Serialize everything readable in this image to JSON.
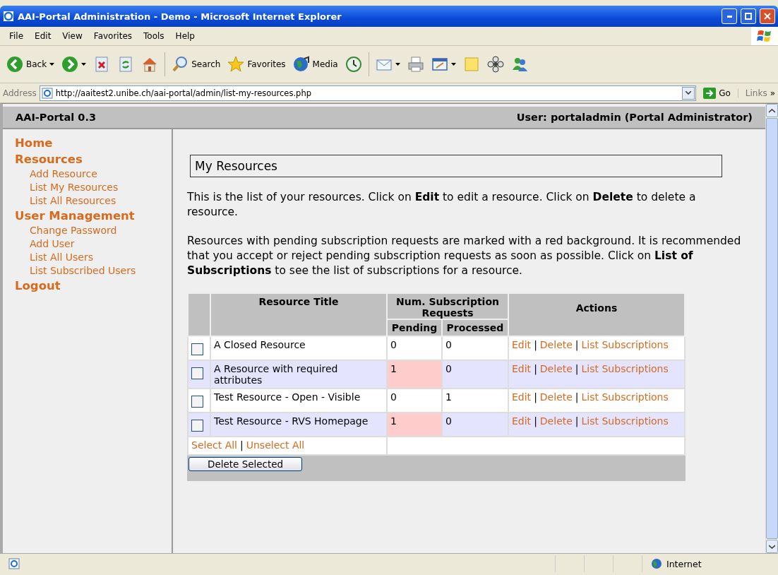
{
  "window": {
    "title": "AAI-Portal Administration - Demo - Microsoft Internet Explorer"
  },
  "menu": [
    "File",
    "Edit",
    "View",
    "Favorites",
    "Tools",
    "Help"
  ],
  "toolbar": [
    {
      "kind": "back",
      "label": "Back",
      "dropdown": true
    },
    {
      "kind": "forward",
      "dropdown": true
    },
    {
      "kind": "stop",
      "dropdown": false
    },
    {
      "kind": "refresh",
      "dropdown": false
    },
    {
      "kind": "home",
      "dropdown": false
    },
    {
      "kind": "search",
      "label": "Search",
      "dropdown": false
    },
    {
      "kind": "favorites",
      "label": "Favorites",
      "dropdown": false
    },
    {
      "kind": "media",
      "label": "Media",
      "dropdown": false
    },
    {
      "kind": "history",
      "dropdown": false
    },
    {
      "kind": "mail",
      "dropdown": true
    },
    {
      "kind": "print",
      "dropdown": false
    },
    {
      "kind": "edit",
      "dropdown": true
    },
    {
      "kind": "note",
      "dropdown": false
    },
    {
      "kind": "flower",
      "dropdown": false
    },
    {
      "kind": "messenger",
      "dropdown": false
    }
  ],
  "address": {
    "label": "Address",
    "value": "http://aaitest2.unibe.ch/aai-portal/admin/list-my-resources.php",
    "go": "Go",
    "links": "Links",
    "more": "»"
  },
  "portal": {
    "name": "AAI-Portal 0.3",
    "user": "User: portaladmin (Portal Administrator)"
  },
  "sidebar": [
    {
      "label": "Home"
    },
    {
      "label": "Resources",
      "children": [
        {
          "label": "Add Resource"
        },
        {
          "label": "List My Resources"
        },
        {
          "label": "List All Resources"
        }
      ]
    },
    {
      "label": "User Management",
      "children": [
        {
          "label": "Change Password"
        },
        {
          "label": "Add User"
        },
        {
          "label": "List All Users"
        },
        {
          "label": "List Subscribed Users"
        }
      ]
    },
    {
      "label": "Logout"
    }
  ],
  "heading": "My Resources",
  "paragraphs": [
    "This is the list of your resources. Click on **Edit** to edit a resource. Click on **Delete** to delete a resource.",
    "Resources with pending subscription requests are marked with a red background. It is recommended that you accept or reject pending subscription requests as soon as possible. Click on **List of Subscriptions** to see the list of subscriptions for a resource."
  ],
  "table": {
    "columns": {
      "title": "Resource Title",
      "requests": "Num. Subscription Requests",
      "pending": "Pending",
      "processed": "Processed",
      "actions": "Actions"
    },
    "rows": [
      {
        "title": "A Closed Resource",
        "pending": "0",
        "processed": "0",
        "checked": false,
        "highlighted": false,
        "actions": [
          "Edit",
          "Delete",
          "List Subscriptions"
        ]
      },
      {
        "title": "A Resource with required attributes",
        "pending": "1",
        "processed": "0",
        "checked": false,
        "highlighted": true,
        "actions": [
          "Edit",
          "Delete",
          "List Subscriptions"
        ]
      },
      {
        "title": "Test Resource - Open - Visible",
        "pending": "0",
        "processed": "1",
        "checked": false,
        "highlighted": false,
        "actions": [
          "Edit",
          "Delete",
          "List Subscriptions"
        ]
      },
      {
        "title": "Test Resource - RVS Homepage",
        "pending": "1",
        "processed": "0",
        "checked": false,
        "highlighted": true,
        "actions": [
          "Edit",
          "Delete",
          "List Subscriptions"
        ]
      }
    ],
    "separator": "|",
    "select_all": "Select All",
    "unselect_all": "Unselect All",
    "delete_button": "Delete Selected"
  },
  "status_bar": {
    "zone": "Internet"
  }
}
